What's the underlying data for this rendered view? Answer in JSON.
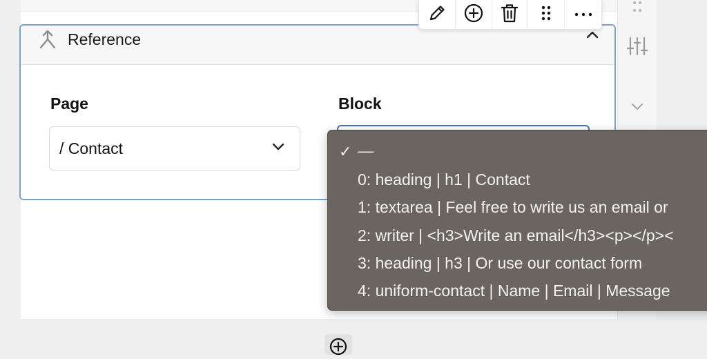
{
  "block": {
    "title": "Reference",
    "fields": {
      "page": {
        "label": "Page",
        "value": "/ Contact"
      },
      "block": {
        "label": "Block",
        "value": "—"
      }
    }
  },
  "dropdown": {
    "selected_mark": "✓",
    "options": [
      {
        "label": "—",
        "selected": true
      },
      {
        "label": "0: heading | h1 | Contact",
        "selected": false
      },
      {
        "label": "1: textarea | Feel free to write us an email or",
        "selected": false
      },
      {
        "label": "2: writer | <h3>Write an email</h3><p></p><",
        "selected": false
      },
      {
        "label": "3: heading | h3 | Or use our contact form",
        "selected": false
      },
      {
        "label": "4: uniform-contact | Name | Email | Message",
        "selected": false
      }
    ]
  },
  "toolbar": {
    "icons": [
      "pencil-icon",
      "add-circle-icon",
      "trash-icon",
      "drag-handle-icon",
      "more-icon"
    ]
  },
  "colors": {
    "focus_border": "#7f9fcb",
    "dropdown_bg": "#6b6561",
    "dropdown_text": "#f4f2f0"
  }
}
